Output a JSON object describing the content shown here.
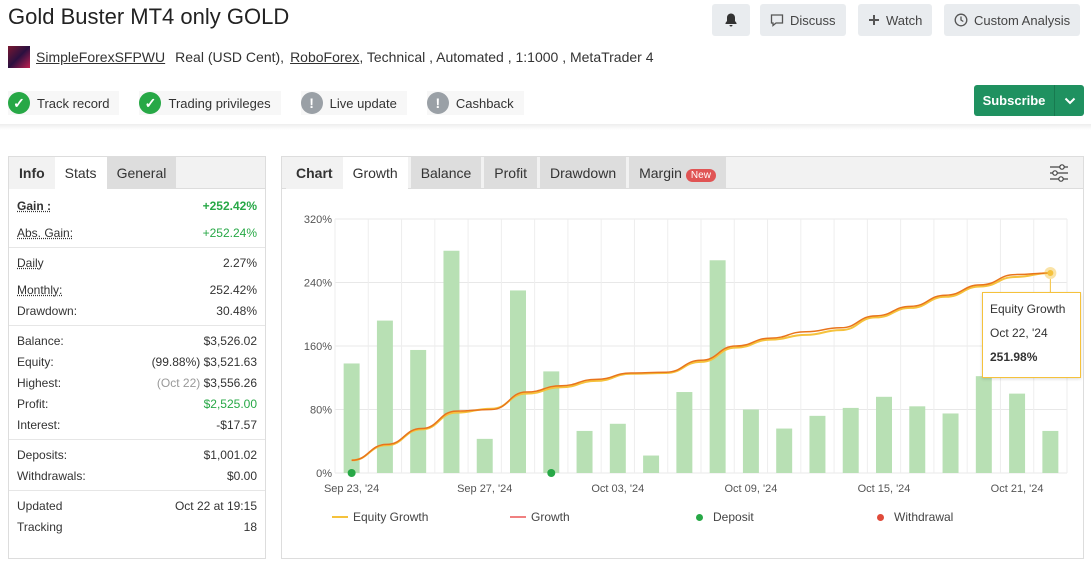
{
  "header": {
    "title": "Gold Buster MT4 only GOLD",
    "buttons": {
      "discuss": "Discuss",
      "watch": "Watch",
      "custom_analysis": "Custom Analysis"
    }
  },
  "meta": {
    "user": "SimpleForexSFPWU",
    "account_type": "Real (USD Cent),",
    "broker": "RoboForex",
    "details": ", Technical , Automated , 1:1000 , MetaTrader 4"
  },
  "badges": [
    {
      "label": "Track record",
      "icon": "check-icon",
      "status": "verified"
    },
    {
      "label": "Trading privileges",
      "icon": "check-icon",
      "status": "verified"
    },
    {
      "label": "Live update",
      "icon": "exclamation-icon",
      "status": "unverified"
    },
    {
      "label": "Cashback",
      "icon": "exclamation-icon",
      "status": "unverified"
    }
  ],
  "subscribe": {
    "label": "Subscribe",
    "color": "#1f9160"
  },
  "stats_panel": {
    "tabs": [
      "Info",
      "Stats",
      "General"
    ],
    "gain_label": "Gain :",
    "gain_value": "+252.42%",
    "abs_gain_label": "Abs. Gain:",
    "abs_gain_value": "+252.24%",
    "daily_label": "Daily",
    "daily_value": "2.27%",
    "monthly_label": "Monthly:",
    "monthly_value": "252.42%",
    "drawdown_label": "Drawdown:",
    "drawdown_value": "30.48%",
    "balance_label": "Balance:",
    "balance_value": "$3,526.02",
    "equity_label": "Equity:",
    "equity_pct": "(99.88%)",
    "equity_value": "$3,521.63",
    "highest_label": "Highest:",
    "highest_date": "(Oct 22)",
    "highest_value": "$3,556.26",
    "profit_label": "Profit:",
    "profit_value": "$2,525.00",
    "interest_label": "Interest:",
    "interest_value": "-$17.57",
    "deposits_label": "Deposits:",
    "deposits_value": "$1,001.02",
    "withdrawals_label": "Withdrawals:",
    "withdrawals_value": "$0.00",
    "updated_label": "Updated",
    "updated_value": "Oct 22 at 19:15",
    "tracking_label": "Tracking",
    "tracking_value": "18"
  },
  "chart_panel": {
    "tabs": [
      "Chart",
      "Growth",
      "Balance",
      "Profit",
      "Drawdown",
      "Margin"
    ],
    "margin_badge": "New",
    "settings_icon": "sliders-icon"
  },
  "tooltip": {
    "title": "Equity Growth",
    "date": "Oct 22, '24",
    "value": "251.98%"
  },
  "chart_data": {
    "type": "bar",
    "x_tick_labels": [
      "Sep 23, '24",
      "Sep 27, '24",
      "Oct 03, '24",
      "Oct 09, '24",
      "Oct 15, '24",
      "Oct 21, '24"
    ],
    "y_tick_labels": [
      "0%",
      "80%",
      "160%",
      "240%",
      "320%"
    ],
    "ylim": [
      0,
      320
    ],
    "grid": true,
    "legend_position": "bottom",
    "bar_color": "#b8e0b4",
    "bars": [
      138,
      192,
      155,
      280,
      43,
      230,
      128,
      53,
      62,
      22,
      102,
      268,
      80,
      56,
      72,
      82,
      96,
      84,
      75,
      122,
      100,
      53
    ],
    "series": [
      {
        "name": "Equity Growth",
        "color": "#f5c23c",
        "values": [
          16,
          35,
          55,
          76,
          81,
          100,
          108,
          116,
          125,
          126,
          140,
          158,
          168,
          174,
          180,
          196,
          208,
          222,
          235,
          247,
          252
        ]
      },
      {
        "name": "Growth",
        "color": "#e8741c",
        "values": [
          16,
          36,
          56,
          78,
          80,
          102,
          110,
          118,
          126,
          127,
          142,
          160,
          170,
          178,
          183,
          198,
          210,
          224,
          237,
          250,
          252
        ]
      }
    ],
    "deposit_markers_bar_index": [
      0,
      6
    ],
    "legend": [
      {
        "label": "Equity Growth",
        "kind": "line",
        "color": "#f5c23c"
      },
      {
        "label": "Growth",
        "kind": "line",
        "color": "#f08080"
      },
      {
        "label": "Deposit",
        "kind": "dot",
        "color": "#27a846"
      },
      {
        "label": "Withdrawal",
        "kind": "dot",
        "color": "#e04a3a"
      }
    ]
  }
}
